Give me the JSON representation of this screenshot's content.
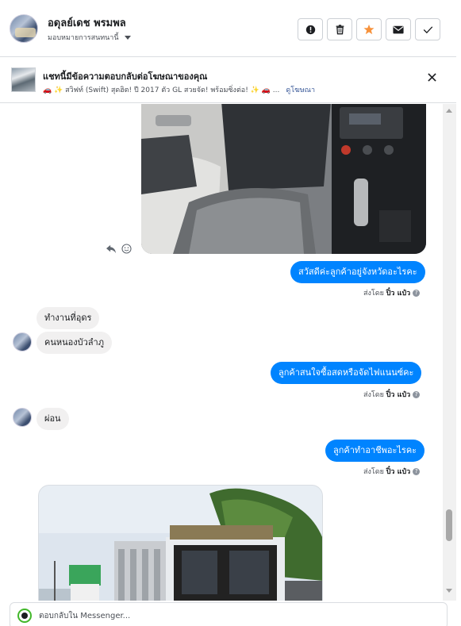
{
  "header": {
    "user_name": "อดุลย์เดช พรมพล",
    "assign_label": "มอบหมายการสนทนานี้",
    "actions": [
      "alert-icon",
      "trash-icon",
      "star-icon",
      "mail-icon",
      "check-icon"
    ],
    "star_color": "#f7923b"
  },
  "ad_banner": {
    "title": "แชทนี้มีข้อความตอบกลับต่อโฆษณาของคุณ",
    "snippet": "🚗 ✨ สวิฟท์ (Swift) สุดฮิต! ปี 2017 ตัว GL สวยจัด! พร้อมซิ่งต่อ! ✨ 🚗 ...",
    "link": "ดูโฆษณา"
  },
  "messages": [
    {
      "type": "image",
      "direction": "in",
      "description": "car-interior-photo"
    },
    {
      "type": "text",
      "direction": "out",
      "text": "สวัสดีค่ะลูกค้าอยู่จังหวัดอะไรคะ"
    },
    {
      "type": "text",
      "direction": "in",
      "text": "ทำงานที่อุดร"
    },
    {
      "type": "text",
      "direction": "in",
      "text": "คนหนองบัวลำภู"
    },
    {
      "type": "text",
      "direction": "out",
      "text": "ลูกค้าสนใจซื้อสดหรือจัดไฟแนนซ์คะ"
    },
    {
      "type": "text",
      "direction": "in",
      "text": "ผ่อน"
    },
    {
      "type": "text",
      "direction": "out",
      "text": "ลูกค้าทำอาชีพอะไรคะ"
    },
    {
      "type": "image",
      "direction": "in",
      "description": "truck-photo"
    }
  ],
  "sent_by": {
    "prefix": "ส่งโดย",
    "name": "ปิ๋ว แป๋ว"
  },
  "composer": {
    "placeholder": "ตอบกลับใน Messenger..."
  },
  "colors": {
    "outgoing_bubble": "#0084ff",
    "incoming_bubble": "#f1f0f0",
    "link": "#385898"
  }
}
